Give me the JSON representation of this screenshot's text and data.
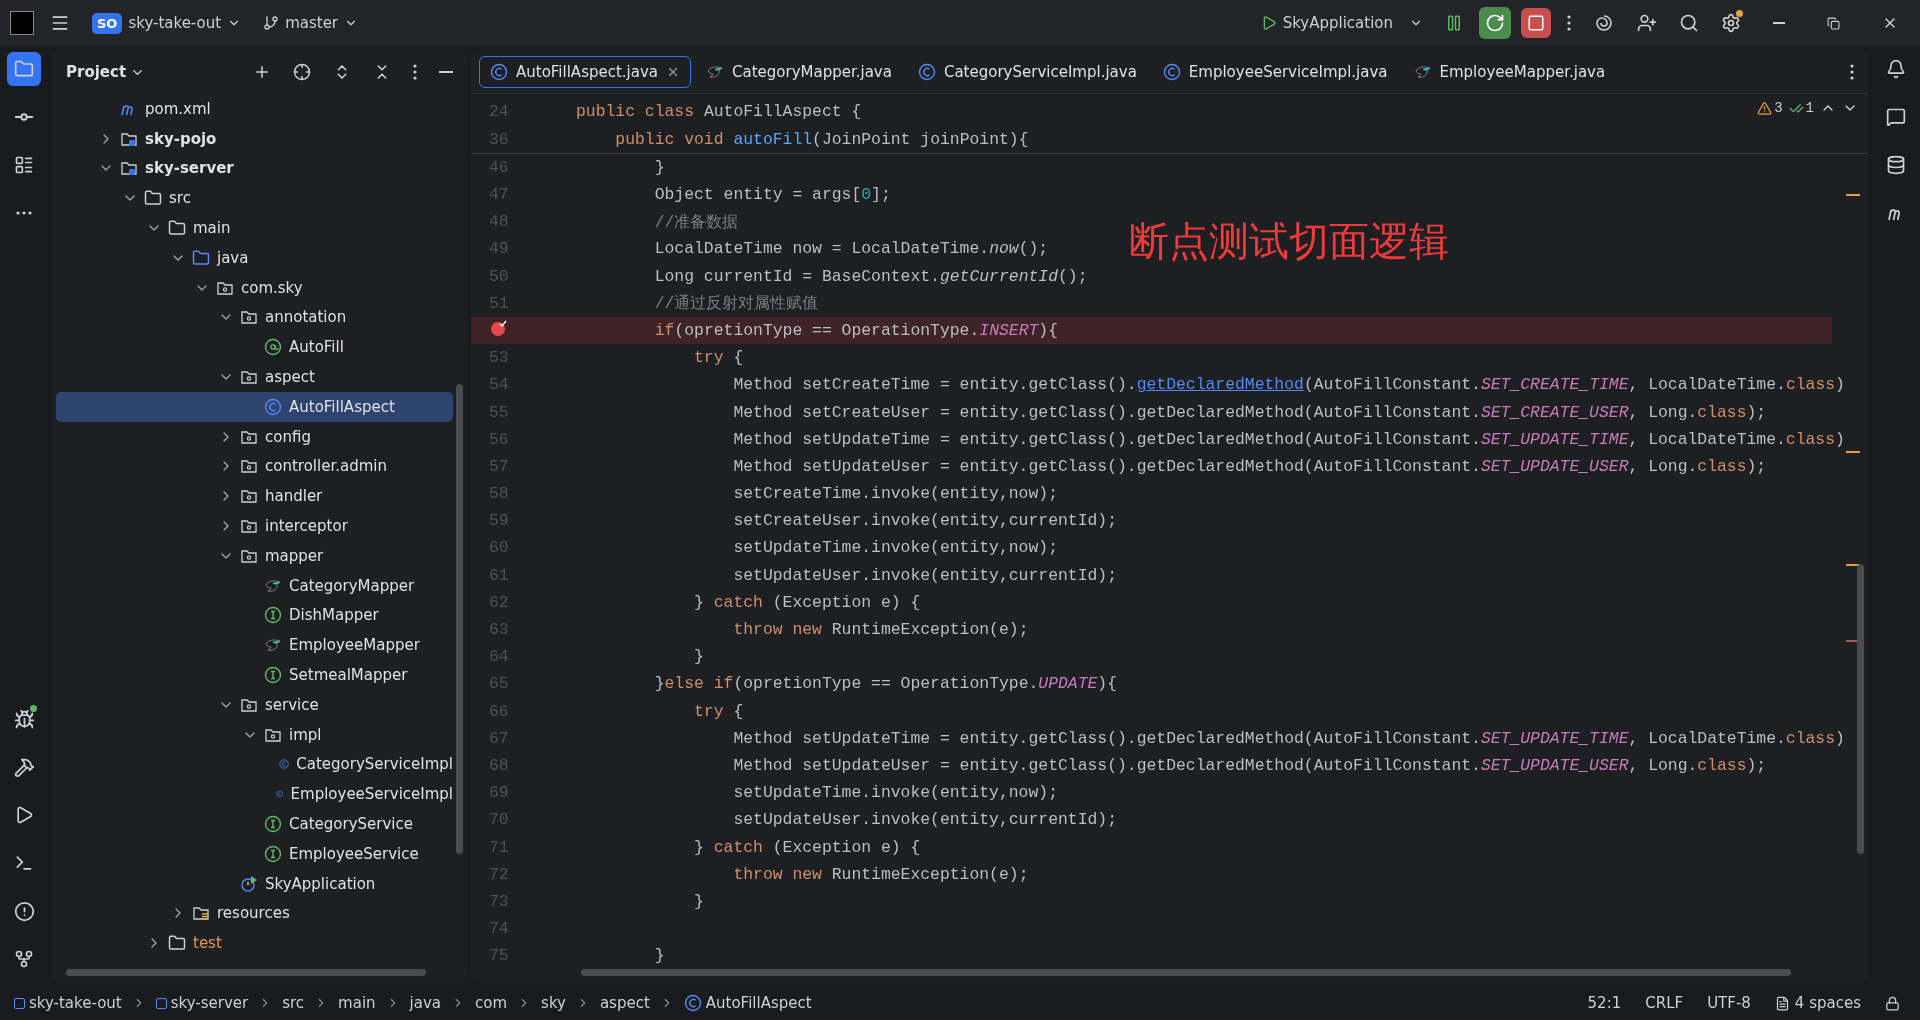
{
  "titlebar": {
    "project_badge": "SO",
    "project": "sky-take-out",
    "branch": "master",
    "run_config": "SkyApplication"
  },
  "project_panel": {
    "title": "Project",
    "tree": [
      {
        "label": "pom.xml",
        "kind": "maven",
        "selected": false
      },
      {
        "label": "sky-pojo",
        "kind": "module",
        "expanded": false,
        "selected": false
      },
      {
        "label": "sky-server",
        "kind": "module",
        "expanded": true,
        "selected": false,
        "children": [
          {
            "label": "src",
            "kind": "folder",
            "expanded": true,
            "selected": false,
            "children": [
              {
                "label": "main",
                "kind": "folder",
                "expanded": true,
                "selected": false,
                "children": [
                  {
                    "label": "java",
                    "kind": "source",
                    "expanded": true,
                    "selected": false,
                    "children": [
                      {
                        "label": "com.sky",
                        "kind": "package",
                        "expanded": true,
                        "selected": false,
                        "children": [
                          {
                            "label": "annotation",
                            "kind": "package",
                            "expanded": true,
                            "selected": false,
                            "children": [
                              {
                                "label": "AutoFill",
                                "kind": "annotation",
                                "selected": false
                              }
                            ]
                          },
                          {
                            "label": "aspect",
                            "kind": "package",
                            "expanded": true,
                            "selected": false,
                            "children": [
                              {
                                "label": "AutoFillAspect",
                                "kind": "class",
                                "selected": true
                              }
                            ]
                          },
                          {
                            "label": "config",
                            "kind": "package",
                            "expanded": false,
                            "selected": false
                          },
                          {
                            "label": "controller.admin",
                            "kind": "package",
                            "expanded": false,
                            "selected": false
                          },
                          {
                            "label": "handler",
                            "kind": "package",
                            "expanded": false,
                            "selected": false
                          },
                          {
                            "label": "interceptor",
                            "kind": "package",
                            "expanded": false,
                            "selected": false
                          },
                          {
                            "label": "mapper",
                            "kind": "package",
                            "expanded": true,
                            "selected": false,
                            "children": [
                              {
                                "label": "CategoryMapper",
                                "kind": "mybatis",
                                "selected": false
                              },
                              {
                                "label": "DishMapper",
                                "kind": "interface",
                                "selected": false
                              },
                              {
                                "label": "EmployeeMapper",
                                "kind": "mybatis",
                                "selected": false
                              },
                              {
                                "label": "SetmealMapper",
                                "kind": "interface",
                                "selected": false
                              }
                            ]
                          },
                          {
                            "label": "service",
                            "kind": "package",
                            "expanded": true,
                            "selected": false,
                            "children": [
                              {
                                "label": "impl",
                                "kind": "package",
                                "expanded": true,
                                "selected": false,
                                "children": [
                                  {
                                    "label": "CategoryServiceImpl",
                                    "kind": "class",
                                    "selected": false
                                  },
                                  {
                                    "label": "EmployeeServiceImpl",
                                    "kind": "class",
                                    "selected": false
                                  }
                                ]
                              },
                              {
                                "label": "CategoryService",
                                "kind": "interface",
                                "selected": false
                              },
                              {
                                "label": "EmployeeService",
                                "kind": "interface",
                                "selected": false
                              }
                            ]
                          },
                          {
                            "label": "SkyApplication",
                            "kind": "spring",
                            "selected": false
                          }
                        ]
                      }
                    ]
                  },
                  {
                    "label": "resources",
                    "kind": "resources",
                    "expanded": false,
                    "selected": false
                  }
                ]
              },
              {
                "label": "test",
                "kind": "test",
                "expanded": false,
                "selected": false
              }
            ]
          }
        ]
      }
    ]
  },
  "tabs": [
    {
      "label": "AutoFillAspect.java",
      "kind": "class",
      "selected": true
    },
    {
      "label": "CategoryMapper.java",
      "kind": "mybatis",
      "selected": false
    },
    {
      "label": "CategoryServiceImpl.java",
      "kind": "class",
      "selected": false
    },
    {
      "label": "EmployeeServiceImpl.java",
      "kind": "class",
      "selected": false
    },
    {
      "label": "EmployeeMapper.java",
      "kind": "mybatis",
      "selected": false
    }
  ],
  "inspections": {
    "warnings": "3",
    "weak_warnings": "1"
  },
  "overlay_note": "断点测试切面逻辑",
  "sticky_lines": [
    {
      "number": "24",
      "tokens": [
        {
          "kind": "kw",
          "text": "public class "
        },
        {
          "kind": "text",
          "text": "AutoFillAspect {"
        }
      ]
    },
    {
      "number": "36",
      "tokens": [
        {
          "kind": "kw",
          "text": "    public void "
        },
        {
          "kind": "fn",
          "text": "autoFill"
        },
        {
          "kind": "text",
          "text": "(JoinPoint joinPoint){"
        }
      ]
    }
  ],
  "lines": [
    {
      "number": "46",
      "breakpoint": false,
      "tokens": [
        {
          "kind": "text",
          "text": "        }"
        }
      ]
    },
    {
      "number": "47",
      "breakpoint": false,
      "tokens": [
        {
          "kind": "text",
          "text": "        Object entity = args["
        },
        {
          "kind": "num",
          "text": "0"
        },
        {
          "kind": "text",
          "text": "];"
        }
      ]
    },
    {
      "number": "48",
      "breakpoint": false,
      "tokens": [
        {
          "kind": "comment",
          "text": "        //准备数据"
        }
      ]
    },
    {
      "number": "49",
      "breakpoint": false,
      "tokens": [
        {
          "kind": "text",
          "text": "        LocalDateTime now = LocalDateTime."
        },
        {
          "kind": "static",
          "text": "now"
        },
        {
          "kind": "text",
          "text": "();"
        }
      ]
    },
    {
      "number": "50",
      "breakpoint": false,
      "tokens": [
        {
          "kind": "text",
          "text": "        Long currentId = BaseContext."
        },
        {
          "kind": "static",
          "text": "getCurrentId"
        },
        {
          "kind": "text",
          "text": "();"
        }
      ]
    },
    {
      "number": "51",
      "breakpoint": false,
      "tokens": [
        {
          "kind": "comment",
          "text": "        //通过反射对属性赋值"
        }
      ]
    },
    {
      "breakpoint": true,
      "tokens": [
        {
          "kind": "kw",
          "text": "        if"
        },
        {
          "kind": "text",
          "text": "(opretionType == OperationType."
        },
        {
          "kind": "const",
          "text": "INSERT"
        },
        {
          "kind": "text",
          "text": "){"
        }
      ]
    },
    {
      "number": "53",
      "breakpoint": false,
      "tokens": [
        {
          "kind": "kw",
          "text": "            try"
        },
        {
          "kind": "text",
          "text": " {"
        }
      ]
    },
    {
      "number": "54",
      "breakpoint": false,
      "tokens": [
        {
          "kind": "text",
          "text": "                Method setCreateTime = entity.getClass()."
        },
        {
          "kind": "link",
          "text": "getDeclaredMethod"
        },
        {
          "kind": "text",
          "text": "(AutoFillConstant."
        },
        {
          "kind": "const",
          "text": "SET_CREATE_TIME"
        },
        {
          "kind": "text",
          "text": ", LocalDateTime."
        },
        {
          "kind": "kw",
          "text": "class"
        },
        {
          "kind": "text",
          "text": ")"
        }
      ]
    },
    {
      "number": "55",
      "breakpoint": false,
      "tokens": [
        {
          "kind": "text",
          "text": "                Method setCreateUser = entity.getClass().getDeclaredMethod(AutoFillConstant."
        },
        {
          "kind": "const",
          "text": "SET_CREATE_USER"
        },
        {
          "kind": "text",
          "text": ", Long."
        },
        {
          "kind": "kw",
          "text": "class"
        },
        {
          "kind": "text",
          "text": ");"
        }
      ]
    },
    {
      "number": "56",
      "breakpoint": false,
      "tokens": [
        {
          "kind": "text",
          "text": "                Method setUpdateTime = entity.getClass().getDeclaredMethod(AutoFillConstant."
        },
        {
          "kind": "const",
          "text": "SET_UPDATE_TIME"
        },
        {
          "kind": "text",
          "text": ", LocalDateTime."
        },
        {
          "kind": "kw",
          "text": "class"
        },
        {
          "kind": "text",
          "text": ")"
        }
      ]
    },
    {
      "number": "57",
      "breakpoint": false,
      "tokens": [
        {
          "kind": "text",
          "text": "                Method setUpdateUser = entity.getClass().getDeclaredMethod(AutoFillConstant."
        },
        {
          "kind": "const",
          "text": "SET_UPDATE_USER"
        },
        {
          "kind": "text",
          "text": ", Long."
        },
        {
          "kind": "kw",
          "text": "class"
        },
        {
          "kind": "text",
          "text": ");"
        }
      ]
    },
    {
      "number": "58",
      "breakpoint": false,
      "tokens": [
        {
          "kind": "text",
          "text": "                setCreateTime.invoke(entity,now);"
        }
      ]
    },
    {
      "number": "59",
      "breakpoint": false,
      "tokens": [
        {
          "kind": "text",
          "text": "                setCreateUser.invoke(entity,currentId);"
        }
      ]
    },
    {
      "number": "60",
      "breakpoint": false,
      "tokens": [
        {
          "kind": "text",
          "text": "                setUpdateTime.invoke(entity,now);"
        }
      ]
    },
    {
      "number": "61",
      "breakpoint": false,
      "tokens": [
        {
          "kind": "text",
          "text": "                setUpdateUser.invoke(entity,currentId);"
        }
      ]
    },
    {
      "number": "62",
      "breakpoint": false,
      "tokens": [
        {
          "kind": "text",
          "text": "            } "
        },
        {
          "kind": "kw",
          "text": "catch"
        },
        {
          "kind": "text",
          "text": " (Exception e) {"
        }
      ]
    },
    {
      "number": "63",
      "breakpoint": false,
      "tokens": [
        {
          "kind": "kw",
          "text": "                throw new"
        },
        {
          "kind": "text",
          "text": " RuntimeException(e);"
        }
      ]
    },
    {
      "number": "64",
      "breakpoint": false,
      "tokens": [
        {
          "kind": "text",
          "text": "            }"
        }
      ]
    },
    {
      "number": "65",
      "breakpoint": false,
      "tokens": [
        {
          "kind": "text",
          "text": "        }"
        },
        {
          "kind": "kw",
          "text": "else if"
        },
        {
          "kind": "text",
          "text": "(opretionType == OperationType."
        },
        {
          "kind": "const",
          "text": "UPDATE"
        },
        {
          "kind": "text",
          "text": "){"
        }
      ]
    },
    {
      "number": "66",
      "breakpoint": false,
      "tokens": [
        {
          "kind": "kw",
          "text": "            try"
        },
        {
          "kind": "text",
          "text": " {"
        }
      ]
    },
    {
      "number": "67",
      "breakpoint": false,
      "tokens": [
        {
          "kind": "text",
          "text": "                Method setUpdateTime = entity.getClass().getDeclaredMethod(AutoFillConstant."
        },
        {
          "kind": "const",
          "text": "SET_UPDATE_TIME"
        },
        {
          "kind": "text",
          "text": ", LocalDateTime."
        },
        {
          "kind": "kw",
          "text": "class"
        },
        {
          "kind": "text",
          "text": ")"
        }
      ]
    },
    {
      "number": "68",
      "breakpoint": false,
      "tokens": [
        {
          "kind": "text",
          "text": "                Method setUpdateUser = entity.getClass().getDeclaredMethod(AutoFillConstant."
        },
        {
          "kind": "const",
          "text": "SET_UPDATE_USER"
        },
        {
          "kind": "text",
          "text": ", Long."
        },
        {
          "kind": "kw",
          "text": "class"
        },
        {
          "kind": "text",
          "text": ");"
        }
      ]
    },
    {
      "number": "69",
      "breakpoint": false,
      "tokens": [
        {
          "kind": "text",
          "text": "                setUpdateTime.invoke(entity,now);"
        }
      ]
    },
    {
      "number": "70",
      "breakpoint": false,
      "tokens": [
        {
          "kind": "text",
          "text": "                setUpdateUser.invoke(entity,currentId);"
        }
      ]
    },
    {
      "number": "71",
      "breakpoint": false,
      "tokens": [
        {
          "kind": "text",
          "text": "            } "
        },
        {
          "kind": "kw",
          "text": "catch"
        },
        {
          "kind": "text",
          "text": " (Exception e) {"
        }
      ]
    },
    {
      "number": "72",
      "breakpoint": false,
      "tokens": [
        {
          "kind": "kw",
          "text": "                throw new"
        },
        {
          "kind": "text",
          "text": " RuntimeException(e);"
        }
      ]
    },
    {
      "number": "73",
      "breakpoint": false,
      "tokens": [
        {
          "kind": "text",
          "text": "            }"
        }
      ]
    },
    {
      "number": "74",
      "breakpoint": false
    },
    {
      "number": "75",
      "breakpoint": false,
      "tokens": [
        {
          "kind": "text",
          "text": "        }"
        }
      ]
    }
  ],
  "breadcrumbs": [
    {
      "label": "sky-take-out",
      "kind": "module"
    },
    {
      "label": "sky-server",
      "kind": "module"
    },
    {
      "label": "src",
      "kind": "plain"
    },
    {
      "label": "main",
      "kind": "plain"
    },
    {
      "label": "java",
      "kind": "plain"
    },
    {
      "label": "com",
      "kind": "plain"
    },
    {
      "label": "sky",
      "kind": "plain"
    },
    {
      "label": "aspect",
      "kind": "plain"
    },
    {
      "label": "AutoFillAspect",
      "kind": "class"
    }
  ],
  "status": {
    "position": "52:1",
    "line_separator": "CRLF",
    "encoding": "UTF-8",
    "indent": "4 spaces"
  }
}
